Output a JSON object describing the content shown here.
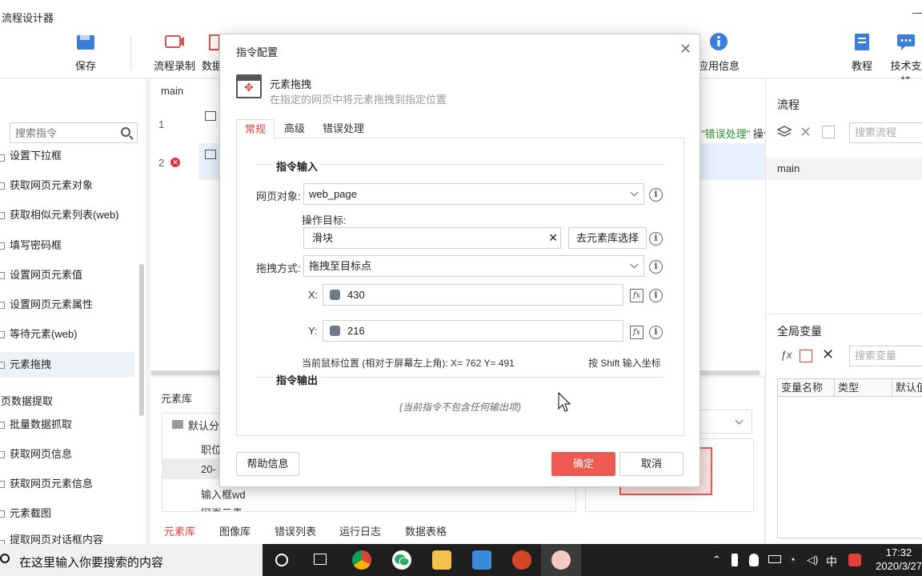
{
  "app": {
    "title": "流程设计器"
  },
  "toolbar": {
    "save": "保存",
    "record": "流程录制",
    "data": "数据",
    "app_info": "应用信息",
    "tutorial": "教程",
    "support": "技术支持"
  },
  "left": {
    "search_placeholder": "搜索指令",
    "items_top": [
      "设置下拉框",
      "获取网页元素对象",
      "获取相似元素列表(web)",
      "填写密码框",
      "设置网页元素值",
      "设置网页元素属性",
      "等待元素(web)",
      "元素拖拽"
    ],
    "category2": "网页数据提取",
    "items_bottom": [
      "批量数据抓取",
      "获取网页信息",
      "获取网页元素信息",
      "元素截图",
      "提取网页对话框内容"
    ]
  },
  "editor": {
    "tab": "main",
    "lines": [
      "1",
      "2"
    ],
    "hint_green": "\"错误处理\"",
    "hint_rest": " 操作"
  },
  "right": {
    "flow_title": "流程",
    "flow_search": "搜索流程",
    "flow_item": "main",
    "globals_title": "全局变量",
    "var_search": "搜索变量",
    "cols": [
      "变量名称",
      "类型",
      "默认值"
    ]
  },
  "bottom": {
    "title": "元素库",
    "tree": [
      "默认分组",
      "职位",
      "20-",
      "输入框wd",
      "网页元素"
    ],
    "tabs": [
      "元素库",
      "图像库",
      "错误列表",
      "运行日志",
      "数据表格"
    ]
  },
  "dialog": {
    "title": "指令配置",
    "cmd_name": "元素拖拽",
    "cmd_desc": "在指定的网页中将元素拖拽到指定位置",
    "tabs": [
      "常规",
      "高级",
      "错误处理"
    ],
    "section_in": "指令输入",
    "web_label": "网页对象:",
    "web_value": "web_page",
    "target_label": "操作目标:",
    "target_value": "滑块",
    "target_btn": "去元素库选择",
    "mode_label": "拖拽方式:",
    "mode_value": "拖拽至目标点",
    "x_label": "X:",
    "x_value": "430",
    "y_label": "Y:",
    "y_value": "216",
    "mouse_pos": "当前鼠标位置 (相对于屏幕左上角):  X= 762 Y= 491",
    "shift_hint": "按 Shift 输入坐标",
    "section_out": "指令输出",
    "no_output": "(当前指令不包含任何输出项)",
    "help_btn": "帮助信息",
    "ok_btn": "确定",
    "cancel_btn": "取消"
  },
  "taskbar": {
    "search": "在这里输入你要搜索的内容",
    "time": "17:32",
    "date": "2020/3/27",
    "ime": "中"
  },
  "colors": {
    "accent": "#e2403a",
    "primary_btn": "#ef5a50"
  }
}
